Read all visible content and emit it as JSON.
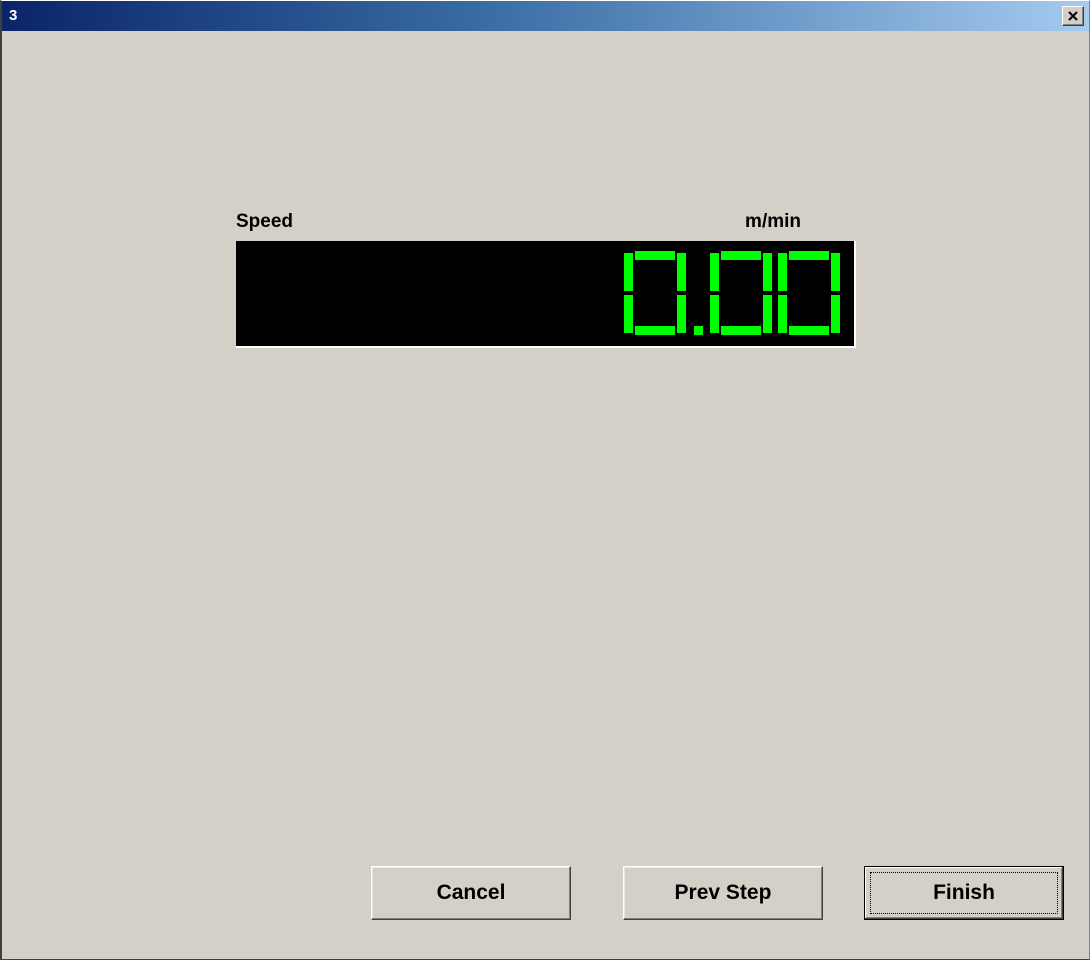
{
  "window": {
    "title": "3",
    "close_icon": "close-icon"
  },
  "speed": {
    "label": "Speed",
    "unit": "m/min",
    "value": "0.00",
    "digit_color": "#00ff00"
  },
  "buttons": {
    "cancel": "Cancel",
    "prev_step": "Prev Step",
    "finish": "Finish"
  }
}
